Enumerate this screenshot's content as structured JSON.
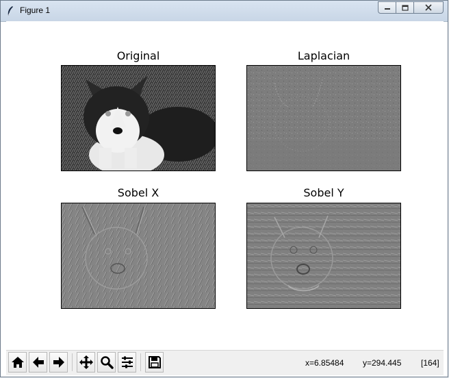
{
  "window": {
    "title": "Figure 1",
    "title_icon": "feather-icon",
    "controls": [
      "minimize-icon",
      "maximize-icon",
      "close-icon"
    ]
  },
  "figure": {
    "panels": [
      {
        "title": "Original",
        "image": "grayscale husky puppy lying on grass"
      },
      {
        "title": "Laplacian",
        "image": "laplacian edge map, mostly flat gray"
      },
      {
        "title": "Sobel X",
        "image": "sobel x-derivative embossed gray image"
      },
      {
        "title": "Sobel Y",
        "image": "sobel y-derivative embossed gray image"
      }
    ]
  },
  "toolbar": {
    "buttons": [
      "home-icon",
      "back-icon",
      "forward-icon",
      "pan-icon",
      "zoom-icon",
      "configure-subplots-icon",
      "save-icon"
    ],
    "x_readout": "x=6.85484",
    "y_readout": "y=294.445",
    "pixel_value": "[164]"
  },
  "colors": {
    "titlebar": "#c8d6e6",
    "toolbar": "#f0f0f0",
    "panel_gray": "#808080"
  }
}
